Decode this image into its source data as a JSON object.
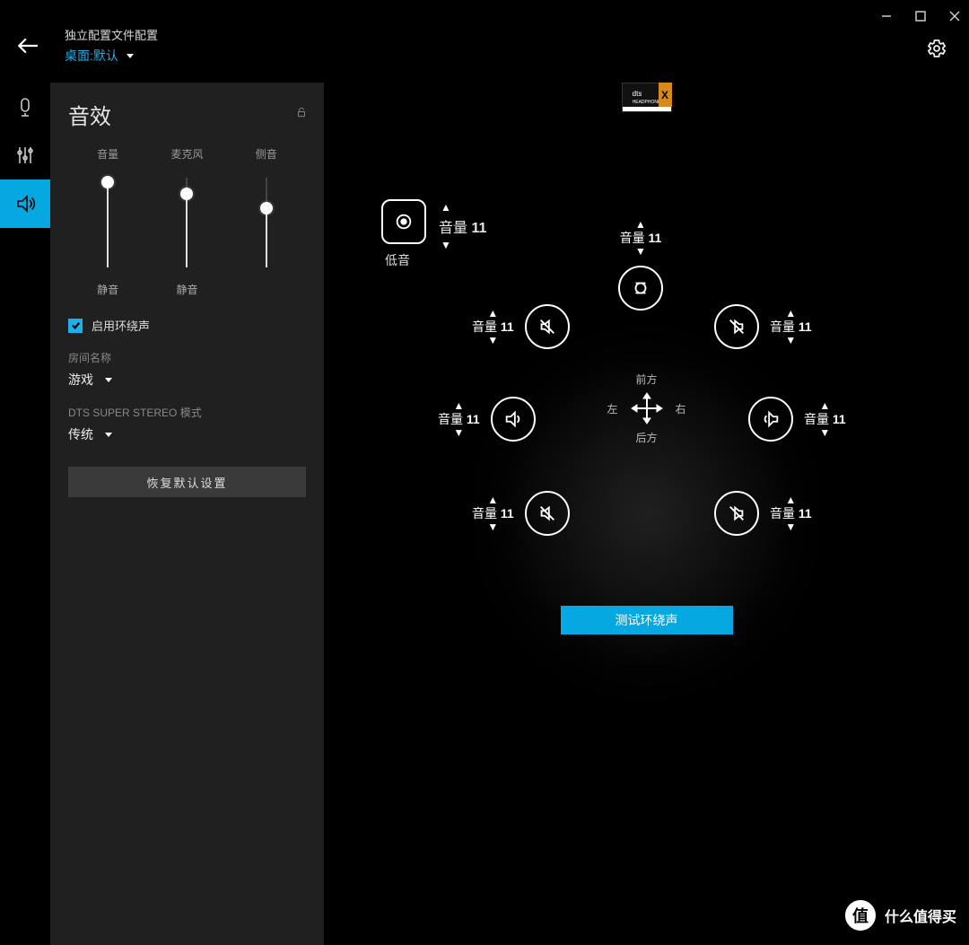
{
  "window": {
    "minimize": "–",
    "maximize": "☐",
    "close": "✕"
  },
  "header": {
    "title": "独立配置文件配置",
    "profile_prefix": "桌面: ",
    "profile_value": "默认"
  },
  "nav": {
    "items": [
      "microphone",
      "equalizer",
      "sound"
    ],
    "active_index": 2
  },
  "panel": {
    "title": "音效",
    "sliders": [
      {
        "label": "音量",
        "mute": "静音",
        "pos": 0.95
      },
      {
        "label": "麦克风",
        "mute": "静音",
        "pos": 0.82
      },
      {
        "label": "侧音",
        "mute": "",
        "pos": 0.66
      }
    ],
    "surround_checkbox": {
      "checked": true,
      "label": "启用环绕声"
    },
    "room_label": "房间名称",
    "room_value": "游戏",
    "dts_label": "DTS SUPER STEREO 模式",
    "dts_value": "传统",
    "reset_button": "恢复默认设置"
  },
  "stage": {
    "dts_badge": {
      "brand": "dts",
      "sub": "HEADPHONE",
      "x": "X"
    },
    "bass": {
      "volume_label": "音量",
      "volume_value": "11",
      "caption": "低音"
    },
    "speakers": {
      "center": {
        "label": "音量",
        "value": "11"
      },
      "front_left": {
        "label": "音量",
        "value": "11"
      },
      "front_right": {
        "label": "音量",
        "value": "11"
      },
      "side_left": {
        "label": "音量",
        "value": "11"
      },
      "side_right": {
        "label": "音量",
        "value": "11"
      },
      "rear_left": {
        "label": "音量",
        "value": "11"
      },
      "rear_right": {
        "label": "音量",
        "value": "11"
      }
    },
    "compass": {
      "front": "前方",
      "rear": "后方",
      "left": "左",
      "right": "右"
    },
    "test_button": "测试环绕声"
  },
  "watermark": "什么值得买"
}
